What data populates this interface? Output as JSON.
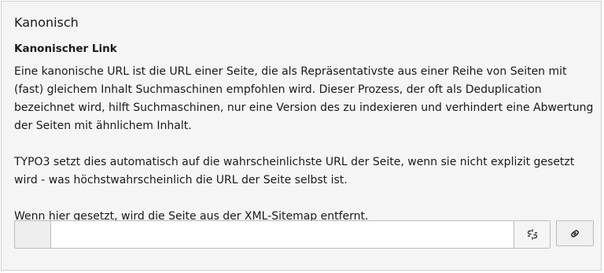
{
  "section": {
    "title": "Kanonisch"
  },
  "field": {
    "label": "Kanonischer Link",
    "description": [
      "Eine kanonische URL ist die URL einer Seite, die als Repräsentativste aus einer Reihe von Seiten mit (fast) gleichem Inhalt Suchmaschinen empfohlen wird. Dieser Prozess, der oft als Deduplication bezeichnet wird, hilft Suchmaschinen, nur eine Version des zu indexieren und verhindert eine Abwertung der Seiten mit ähnlichem Inhalt.",
      "TYPO3 setzt dies automatisch auf die wahrscheinlichste URL der Seite, wenn sie nicht explizit gesetzt wird - was höchstwahrscheinlich die URL der Seite selbst ist.",
      "Wenn hier gesetzt, wird die Seite aus der XML-Sitemap entfernt."
    ],
    "input_value": "",
    "icons": {
      "addon": "",
      "clear": "unlink-icon",
      "browse": "link-icon"
    }
  }
}
